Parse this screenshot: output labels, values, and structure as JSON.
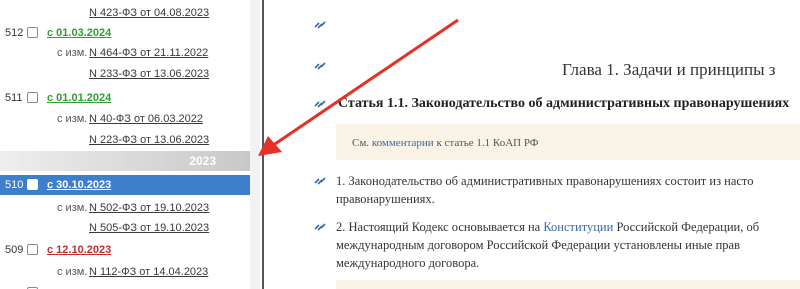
{
  "sidebar": {
    "rows": [
      {
        "link": "N 423-ФЗ от 04.08.2023"
      },
      {
        "num": "512",
        "date": "с 01.03.2024"
      },
      {
        "label": "с изм.",
        "link": "N 464-ФЗ от 21.11.2022"
      },
      {
        "link": "N 233-ФЗ от 13.06.2023"
      },
      {
        "num": "511",
        "date": "с 01.01.2024"
      },
      {
        "label": "с изм.",
        "link": "N 40-ФЗ от 06.03.2022"
      },
      {
        "link": "N 223-ФЗ от 13.06.2023"
      },
      {
        "num": "510",
        "date": "с 30.10.2023"
      },
      {
        "label": "с изм.",
        "link": "N 502-ФЗ от 19.10.2023"
      },
      {
        "link": "N 505-ФЗ от 19.10.2023"
      },
      {
        "num": "509",
        "date": "с 12.10.2023"
      },
      {
        "label": "с изм.",
        "link": "N 112-ФЗ от 14.04.2023"
      }
    ],
    "year": "2023",
    "colors": {
      "green": "#2e9e2e",
      "red": "#c0302c",
      "selected": "#3d7fcb"
    }
  },
  "doc": {
    "chapter": "Глава 1. Задачи и принципы з",
    "article": "Статья 1.1. Законодательство об административных правонарушениях",
    "note": {
      "prefix": "См. ",
      "link": "комментарии",
      "suffix": " к статье 1.1 КоАП РФ"
    },
    "p1_line1": "1. Законодательство об административных правонарушениях состоит из насто",
    "p1_line2": "правонарушениях.",
    "p2_prefix": "2. Настоящий Кодекс основывается на ",
    "p2_link": "Конституции",
    "p2_suffix": " Российской Федерации, об",
    "p2_line2": "международным договором Российской Федерации установлены иные прав",
    "p2_line3": "международного договора."
  },
  "annotation": {
    "arrow_color": "#e53027",
    "icon": "red-arrow"
  }
}
